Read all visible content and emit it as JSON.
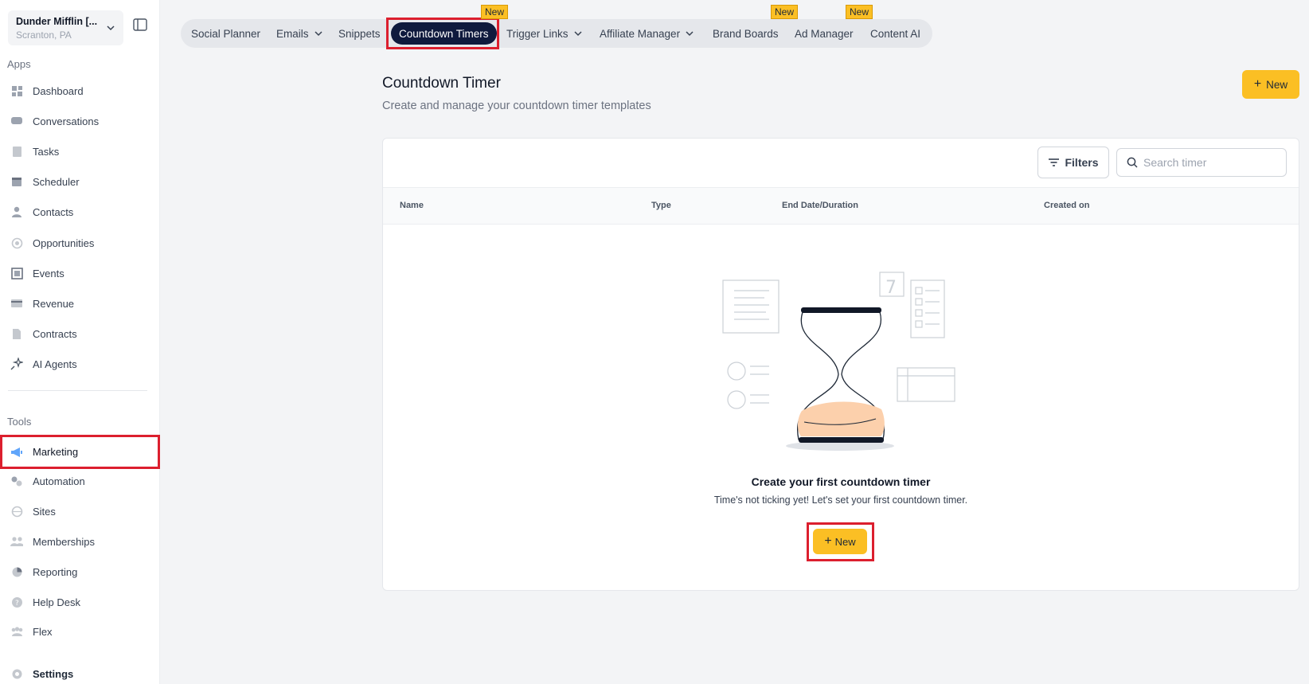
{
  "account": {
    "name": "Dunder Mifflin [...",
    "location": "Scranton, PA"
  },
  "sidebar": {
    "apps_label": "Apps",
    "tools_label": "Tools",
    "apps": [
      {
        "label": "Dashboard",
        "icon": "dashboard-icon"
      },
      {
        "label": "Conversations",
        "icon": "chat-icon"
      },
      {
        "label": "Tasks",
        "icon": "tasks-icon"
      },
      {
        "label": "Scheduler",
        "icon": "calendar-icon"
      },
      {
        "label": "Contacts",
        "icon": "person-icon"
      },
      {
        "label": "Opportunities",
        "icon": "target-icon"
      },
      {
        "label": "Events",
        "icon": "events-icon"
      },
      {
        "label": "Revenue",
        "icon": "card-icon"
      },
      {
        "label": "Contracts",
        "icon": "document-icon"
      },
      {
        "label": "AI Agents",
        "icon": "sparkle-icon"
      }
    ],
    "tools": [
      {
        "label": "Marketing",
        "icon": "megaphone-icon",
        "active": true
      },
      {
        "label": "Automation",
        "icon": "gears-icon"
      },
      {
        "label": "Sites",
        "icon": "globe-icon"
      },
      {
        "label": "Memberships",
        "icon": "people-icon"
      },
      {
        "label": "Reporting",
        "icon": "pie-icon"
      },
      {
        "label": "Help Desk",
        "icon": "help-icon"
      },
      {
        "label": "Flex",
        "icon": "group-icon"
      }
    ],
    "settings_label": "Settings"
  },
  "topnav": {
    "tabs": [
      {
        "label": "Social Planner"
      },
      {
        "label": "Emails",
        "dropdown": true
      },
      {
        "label": "Snippets"
      },
      {
        "label": "Countdown Timers",
        "active": true,
        "badge": "New"
      },
      {
        "label": "Trigger Links",
        "dropdown": true
      },
      {
        "label": "Affiliate Manager",
        "dropdown": true
      },
      {
        "label": "Brand Boards",
        "badge": "New"
      },
      {
        "label": "Ad Manager",
        "badge": "New"
      },
      {
        "label": "Content AI"
      }
    ]
  },
  "page": {
    "title": "Countdown Timer",
    "subtitle": "Create and manage your countdown timer templates",
    "new_label": "New"
  },
  "toolbar": {
    "filters_label": "Filters",
    "search_placeholder": "Search timer"
  },
  "table": {
    "columns": [
      "Name",
      "Type",
      "End Date/Duration",
      "Created on"
    ]
  },
  "empty_state": {
    "title": "Create your first countdown timer",
    "subtitle": "Time's not ticking yet! Let's set your first countdown timer.",
    "button_label": "New"
  },
  "colors": {
    "accent": "#fbbf24",
    "nav_active": "#0f1a3d",
    "highlight": "#dc1f2e"
  }
}
